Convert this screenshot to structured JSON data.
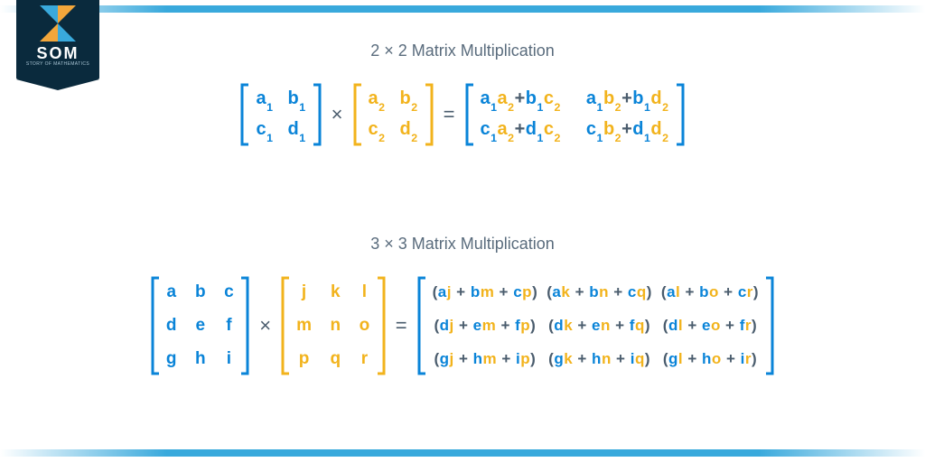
{
  "logo": {
    "text": "SOM",
    "subtitle": "STORY OF MATHEMATICS"
  },
  "section1": {
    "title": "2 × 2 Matrix Multiplication"
  },
  "section2": {
    "title": "3 × 3 Matrix Multiplication"
  },
  "colors": {
    "blue": "#0a84d8",
    "yellow": "#f2b31c",
    "accent": "#39a9dc",
    "brand": "#0a2a3d"
  },
  "m2": {
    "A": {
      "r1c1": "a",
      "r1c1s": "1",
      "r1c2": "b",
      "r1c2s": "1",
      "r2c1": "c",
      "r2c1s": "1",
      "r2c2": "d",
      "r2c2s": "1"
    },
    "B": {
      "r1c1": "a",
      "r1c1s": "2",
      "r1c2": "b",
      "r1c2s": "2",
      "r2c1": "c",
      "r2c1s": "2",
      "r2c2": "d",
      "r2c2s": "2"
    },
    "op_mul": "×",
    "op_eq": "=",
    "op_plus": "+",
    "C": {
      "r1c1_p1a": "a",
      "r1c1_p1as": "1",
      "r1c1_p1b": "a",
      "r1c1_p1bs": "2",
      "r1c1_p2a": "b",
      "r1c1_p2as": "1",
      "r1c1_p2b": "c",
      "r1c1_p2bs": "2",
      "r1c2_p1a": "a",
      "r1c2_p1as": "1",
      "r1c2_p1b": "b",
      "r1c2_p1bs": "2",
      "r1c2_p2a": "b",
      "r1c2_p2as": "1",
      "r1c2_p2b": "d",
      "r1c2_p2bs": "2",
      "r2c1_p1a": "c",
      "r2c1_p1as": "1",
      "r2c1_p1b": "a",
      "r2c1_p1bs": "2",
      "r2c1_p2a": "d",
      "r2c1_p2as": "1",
      "r2c1_p2b": "c",
      "r2c1_p2bs": "2",
      "r2c2_p1a": "c",
      "r2c2_p1as": "1",
      "r2c2_p1b": "b",
      "r2c2_p1bs": "2",
      "r2c2_p2a": "d",
      "r2c2_p2as": "1",
      "r2c2_p2b": "d",
      "r2c2_p2bs": "2"
    }
  },
  "m3": {
    "op_mul": "×",
    "op_eq": "=",
    "plus": " + ",
    "A": {
      "r1c1": "a",
      "r1c2": "b",
      "r1c3": "c",
      "r2c1": "d",
      "r2c2": "e",
      "r2c3": "f",
      "r3c1": "g",
      "r3c2": "h",
      "r3c3": "i"
    },
    "B": {
      "r1c1": "j",
      "r1c2": "k",
      "r1c3": "l",
      "r2c1": "m",
      "r2c2": "n",
      "r2c3": "o",
      "r3c1": "p",
      "r3c2": "q",
      "r3c3": "r"
    },
    "C": {
      "r1c1": {
        "t1a": "a",
        "t1b": "j",
        "t2a": "b",
        "t2b": "m",
        "t3a": "c",
        "t3b": "p"
      },
      "r1c2": {
        "t1a": "a",
        "t1b": "k",
        "t2a": "b",
        "t2b": "n",
        "t3a": "c",
        "t3b": "q"
      },
      "r1c3": {
        "t1a": "a",
        "t1b": "l",
        "t2a": "b",
        "t2b": "o",
        "t3a": "c",
        "t3b": "r"
      },
      "r2c1": {
        "t1a": "d",
        "t1b": "j",
        "t2a": "e",
        "t2b": "m",
        "t3a": "f",
        "t3b": "p"
      },
      "r2c2": {
        "t1a": "d",
        "t1b": "k",
        "t2a": "e",
        "t2b": "n",
        "t3a": "f",
        "t3b": "q"
      },
      "r2c3": {
        "t1a": "d",
        "t1b": "l",
        "t2a": "e",
        "t2b": "o",
        "t3a": "f",
        "t3b": "r"
      },
      "r3c1": {
        "t1a": "g",
        "t1b": "j",
        "t2a": "h",
        "t2b": "m",
        "t3a": "i",
        "t3b": "p"
      },
      "r3c2": {
        "t1a": "g",
        "t1b": "k",
        "t2a": "h",
        "t2b": "n",
        "t3a": "i",
        "t3b": "q"
      },
      "r3c3": {
        "t1a": "g",
        "t1b": "l",
        "t2a": "h",
        "t2b": "o",
        "t3a": "i",
        "t3b": "r"
      }
    },
    "lp": "(",
    "rp": ")"
  }
}
